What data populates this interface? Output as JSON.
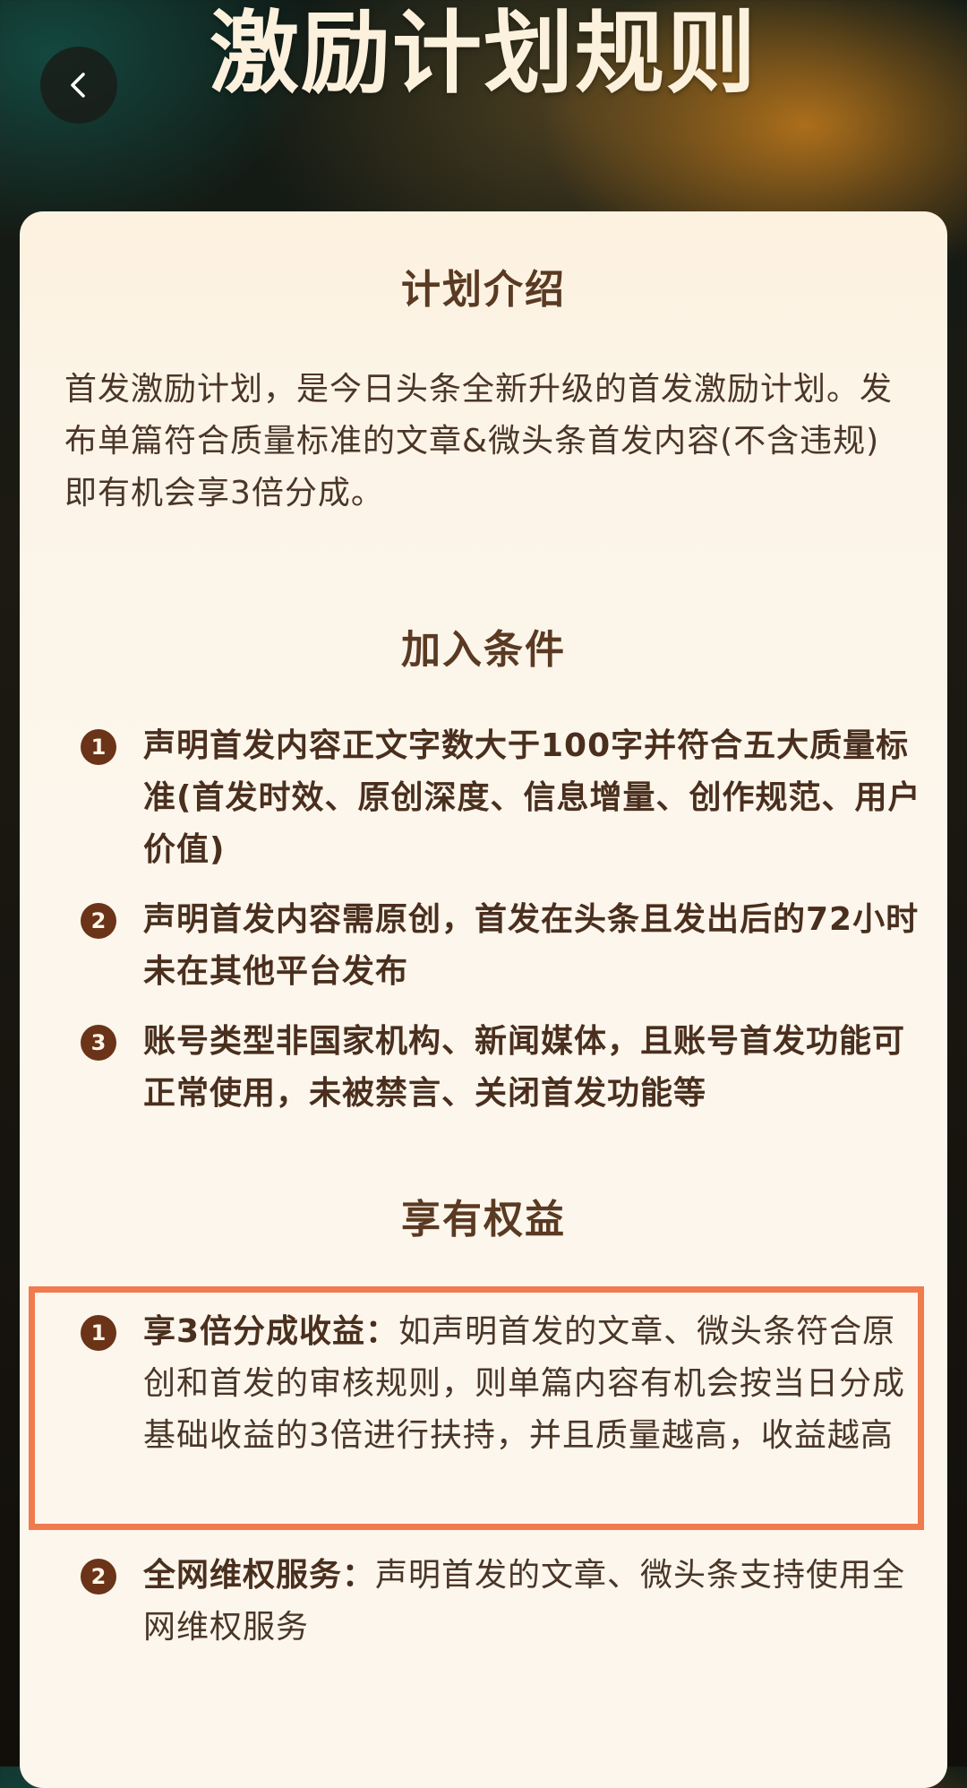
{
  "header": {
    "title": "激励计划规则",
    "back_icon": "chevron-left-icon"
  },
  "sections": {
    "intro": {
      "title": "计划介绍",
      "text": "首发激励计划，是今日头条全新升级的首发激励计划。发布单篇符合质量标准的文章&微头条首发内容(不含违规)即有机会享3倍分成。"
    },
    "conditions": {
      "title": "加入条件",
      "items": [
        {
          "num": "1",
          "text": "声明首发内容正文字数大于100字并符合五大质量标准(首发时效、原创深度、信息增量、创作规范、用户价值)"
        },
        {
          "num": "2",
          "text": "声明首发内容需原创，首发在头条且发出后的72小时未在其他平台发布"
        },
        {
          "num": "3",
          "text": "账号类型非国家机构、新闻媒体，且账号首发功能可正常使用，未被禁言、关闭首发功能等"
        }
      ]
    },
    "benefits": {
      "title": "享有权益",
      "items": [
        {
          "num": "1",
          "lead": "享3倍分成收益：",
          "text": "如声明首发的文章、微头条符合原创和首发的审核规则，则单篇内容有机会按当日分成基础收益的3倍进行扶持，并且质量越高，收益越高"
        },
        {
          "num": "2",
          "lead": "全网维权服务：",
          "text": "声明首发的文章、微头条支持使用全网维权服务"
        }
      ]
    }
  },
  "colors": {
    "highlight_border": "#ef7b4e",
    "number_badge": "#6b3318",
    "title_text": "#5a3a22"
  }
}
